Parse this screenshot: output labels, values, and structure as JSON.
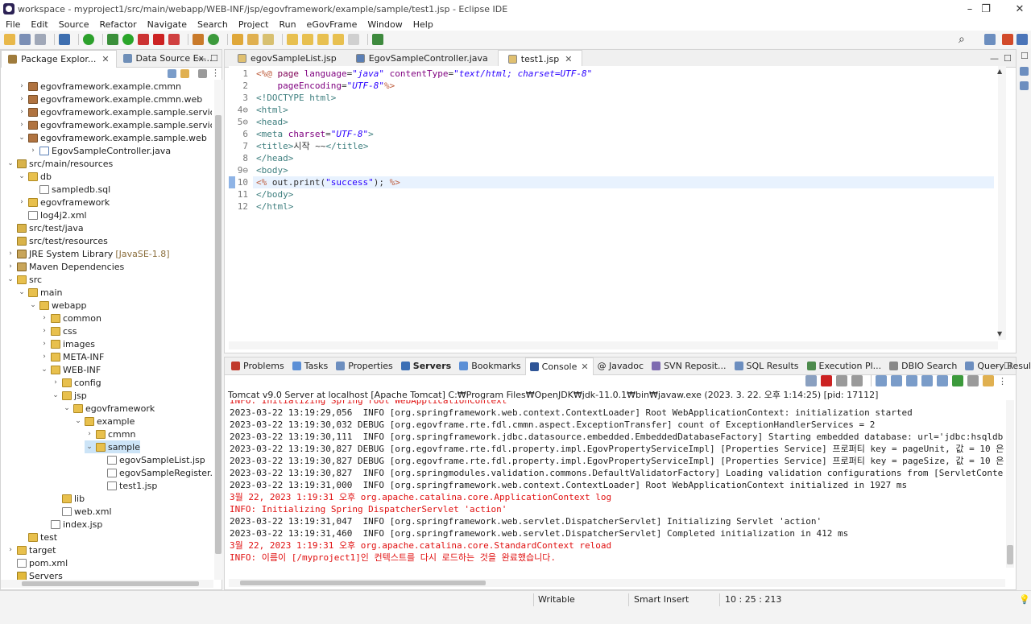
{
  "window": {
    "title": "workspace - myproject1/src/main/webapp/WEB-INF/jsp/egovframework/example/sample/test1.jsp - Eclipse IDE",
    "minimize": "–",
    "restore": "❐",
    "close": "✕"
  },
  "menu": [
    "File",
    "Edit",
    "Source",
    "Refactor",
    "Navigate",
    "Search",
    "Project",
    "Run",
    "eGovFrame",
    "Window",
    "Help"
  ],
  "left_tabs": [
    {
      "label": "Package Explor...",
      "close": "✕"
    },
    {
      "label": "Data Source Ex..."
    }
  ],
  "tree": [
    {
      "indent": 1,
      "arrow": "›",
      "icon": "pkg",
      "label": "egovframework.example.cmmn"
    },
    {
      "indent": 1,
      "arrow": "›",
      "icon": "pkg",
      "label": "egovframework.example.cmmn.web"
    },
    {
      "indent": 1,
      "arrow": "›",
      "icon": "pkg",
      "label": "egovframework.example.sample.service"
    },
    {
      "indent": 1,
      "arrow": "›",
      "icon": "pkg",
      "label": "egovframework.example.sample.service.impl"
    },
    {
      "indent": 1,
      "arrow": "⌄",
      "icon": "pkg",
      "label": "egovframework.example.sample.web"
    },
    {
      "indent": 2,
      "arrow": "›",
      "icon": "java",
      "label": "EgovSampleController.java"
    },
    {
      "indent": 0,
      "arrow": "⌄",
      "icon": "src",
      "label": "src/main/resources"
    },
    {
      "indent": 1,
      "arrow": "⌄",
      "icon": "fold",
      "label": "db"
    },
    {
      "indent": 2,
      "arrow": "",
      "icon": "file",
      "label": "sampledb.sql"
    },
    {
      "indent": 1,
      "arrow": "›",
      "icon": "fold",
      "label": "egovframework"
    },
    {
      "indent": 1,
      "arrow": "",
      "icon": "file",
      "label": "log4j2.xml"
    },
    {
      "indent": 0,
      "arrow": "",
      "icon": "src",
      "label": "src/test/java"
    },
    {
      "indent": 0,
      "arrow": "",
      "icon": "src",
      "label": "src/test/resources"
    },
    {
      "indent": 0,
      "arrow": "›",
      "icon": "lib",
      "label": "JRE System Library",
      "sub": "[JavaSE-1.8]"
    },
    {
      "indent": 0,
      "arrow": "›",
      "icon": "lib",
      "label": "Maven Dependencies"
    },
    {
      "indent": 0,
      "arrow": "⌄",
      "icon": "fold",
      "label": "src"
    },
    {
      "indent": 1,
      "arrow": "⌄",
      "icon": "fold",
      "label": "main"
    },
    {
      "indent": 2,
      "arrow": "⌄",
      "icon": "fold",
      "label": "webapp"
    },
    {
      "indent": 3,
      "arrow": "›",
      "icon": "fold",
      "label": "common"
    },
    {
      "indent": 3,
      "arrow": "›",
      "icon": "fold",
      "label": "css"
    },
    {
      "indent": 3,
      "arrow": "›",
      "icon": "fold",
      "label": "images"
    },
    {
      "indent": 3,
      "arrow": "›",
      "icon": "fold",
      "label": "META-INF"
    },
    {
      "indent": 3,
      "arrow": "⌄",
      "icon": "fold",
      "label": "WEB-INF"
    },
    {
      "indent": 4,
      "arrow": "›",
      "icon": "fold",
      "label": "config"
    },
    {
      "indent": 4,
      "arrow": "⌄",
      "icon": "fold",
      "label": "jsp"
    },
    {
      "indent": 5,
      "arrow": "⌄",
      "icon": "fold",
      "label": "egovframework"
    },
    {
      "indent": 6,
      "arrow": "⌄",
      "icon": "fold",
      "label": "example"
    },
    {
      "indent": 7,
      "arrow": "›",
      "icon": "fold",
      "label": "cmmn"
    },
    {
      "indent": 7,
      "arrow": "⌄",
      "icon": "fold",
      "label": "sample",
      "selected": true
    },
    {
      "indent": 8,
      "arrow": "",
      "icon": "file",
      "label": "egovSampleList.jsp"
    },
    {
      "indent": 8,
      "arrow": "",
      "icon": "file",
      "label": "egovSampleRegister.jsp"
    },
    {
      "indent": 8,
      "arrow": "",
      "icon": "file",
      "label": "test1.jsp"
    },
    {
      "indent": 4,
      "arrow": "",
      "icon": "fold",
      "label": "lib"
    },
    {
      "indent": 4,
      "arrow": "",
      "icon": "file",
      "label": "web.xml"
    },
    {
      "indent": 3,
      "arrow": "",
      "icon": "file",
      "label": "index.jsp"
    },
    {
      "indent": 1,
      "arrow": "",
      "icon": "fold",
      "label": "test"
    },
    {
      "indent": 0,
      "arrow": "›",
      "icon": "fold",
      "label": "target"
    },
    {
      "indent": 0,
      "arrow": "",
      "icon": "file",
      "label": "pom.xml"
    },
    {
      "indent": 0,
      "arrow": "",
      "icon": "prj",
      "label": "Servers"
    }
  ],
  "editor_tabs": [
    {
      "label": "egovSampleList.jsp"
    },
    {
      "label": "EgovSampleController.java"
    },
    {
      "label": "test1.jsp",
      "active": true,
      "close": "✕"
    }
  ],
  "code_lines": [
    {
      "n": "1",
      "html": "<span class=\"p\">&lt;%@</span> <span class=\"k\">page</span> <span class=\"a\">language</span>=<span class=\"s\">\"java\"</span> <span class=\"a\">contentType</span>=<span class=\"s\">\"text/html; charset=UTF-8\"</span>"
    },
    {
      "n": "2",
      "html": "    <span class=\"a\">pageEncoding</span>=<span class=\"s\">\"UTF-8\"</span><span class=\"p\">%&gt;</span>"
    },
    {
      "n": "3",
      "html": "<span class=\"t\">&lt;!DOCTYPE html&gt;</span>"
    },
    {
      "n": "4⊖",
      "html": "<span class=\"t\">&lt;html&gt;</span>"
    },
    {
      "n": "5⊖",
      "html": "<span class=\"t\">&lt;head&gt;</span>"
    },
    {
      "n": "6",
      "html": "<span class=\"t\">&lt;meta</span> <span class=\"a\">charset</span>=<span class=\"s\">\"UTF-8\"</span><span class=\"t\">&gt;</span>"
    },
    {
      "n": "7",
      "html": "<span class=\"t\">&lt;title&gt;</span>시작 ~~<span class=\"t\">&lt;/title&gt;</span>"
    },
    {
      "n": "8",
      "html": "<span class=\"t\">&lt;/head&gt;</span>"
    },
    {
      "n": "9⊖",
      "html": "<span class=\"t\">&lt;body&gt;</span>"
    },
    {
      "n": "10",
      "html": "<span class=\"p\">&lt;%</span> out.print(<span class=\"j\">\"success\"</span>); <span class=\"p\">%&gt;</span>",
      "current": true
    },
    {
      "n": "11",
      "html": "<span class=\"t\">&lt;/body&gt;</span>"
    },
    {
      "n": "12",
      "html": "<span class=\"t\">&lt;/html&gt;</span>"
    }
  ],
  "bottom_tabs": [
    {
      "label": "Problems",
      "color": "#c0392b"
    },
    {
      "label": "Tasks",
      "color": "#5b8fd6"
    },
    {
      "label": "Properties",
      "color": "#6c8ebf"
    },
    {
      "label": "Servers",
      "color": "#3c6fb5",
      "bold": true
    },
    {
      "label": "Bookmarks",
      "color": "#5b8fd6"
    },
    {
      "label": "Console",
      "color": "#2f5597",
      "active": true,
      "close": "✕"
    },
    {
      "label": "@ Javadoc",
      "color": ""
    },
    {
      "label": "SVN Reposit...",
      "color": "#7e6bb0"
    },
    {
      "label": "SQL Results",
      "color": "#6c8ebf"
    },
    {
      "label": "Execution Pl...",
      "color": "#4c8a4c"
    },
    {
      "label": "DBIO Search",
      "color": "#888"
    },
    {
      "label": "Query Result",
      "color": "#6c8ebf"
    }
  ],
  "console_header": "Tomcat v9.0 Server at localhost [Apache Tomcat] C:₩Program Files₩OpenJDK₩jdk-11.0.1₩bin₩javaw.exe  (2023. 3. 22. 오후 1:14:25) [pid: 17112]",
  "console_lines": [
    {
      "text": "INFO: Initializing Spring root WebApplicationContext",
      "red": true
    },
    {
      "text": "2023-03-22 13:19:29,056  INFO [org.springframework.web.context.ContextLoader] Root WebApplicationContext: initialization started"
    },
    {
      "text": "2023-03-22 13:19:30,032 DEBUG [org.egovframe.rte.fdl.cmmn.aspect.ExceptionTransfer] count of ExceptionHandlerServices = 2"
    },
    {
      "text": "2023-03-22 13:19:30,111  INFO [org.springframework.jdbc.datasource.embedded.EmbeddedDatabaseFactory] Starting embedded database: url='jdbc:hsqldb"
    },
    {
      "text": "2023-03-22 13:19:30,827 DEBUG [org.egovframe.rte.fdl.property.impl.EgovPropertyServiceImpl] [Properties Service] 프로퍼티 key = pageUnit, 값 = 10 은"
    },
    {
      "text": "2023-03-22 13:19:30,827 DEBUG [org.egovframe.rte.fdl.property.impl.EgovPropertyServiceImpl] [Properties Service] 프로퍼티 key = pageSize, 값 = 10 은"
    },
    {
      "text": "2023-03-22 13:19:30,827  INFO [org.springmodules.validation.commons.DefaultValidatorFactory] Loading validation configurations from [ServletConte"
    },
    {
      "text": "2023-03-22 13:19:31,000  INFO [org.springframework.web.context.ContextLoader] Root WebApplicationContext initialized in 1927 ms"
    },
    {
      "text": "3월 22, 2023 1:19:31 오후 org.apache.catalina.core.ApplicationContext log",
      "red": true
    },
    {
      "text": "INFO: Initializing Spring DispatcherServlet 'action'",
      "red": true
    },
    {
      "text": "2023-03-22 13:19:31,047  INFO [org.springframework.web.servlet.DispatcherServlet] Initializing Servlet 'action'"
    },
    {
      "text": "2023-03-22 13:19:31,460  INFO [org.springframework.web.servlet.DispatcherServlet] Completed initialization in 412 ms"
    },
    {
      "text": "3월 22, 2023 1:19:31 오후 org.apache.catalina.core.StandardContext reload",
      "red": true
    },
    {
      "text": "INFO: 이름이 [/myproject1]인 컨텍스트를 다시 로드하는 것을 완료했습니다.",
      "red": true
    }
  ],
  "status": {
    "writable": "Writable",
    "insert_mode": "Smart Insert",
    "position": "10 : 25 : 213"
  }
}
